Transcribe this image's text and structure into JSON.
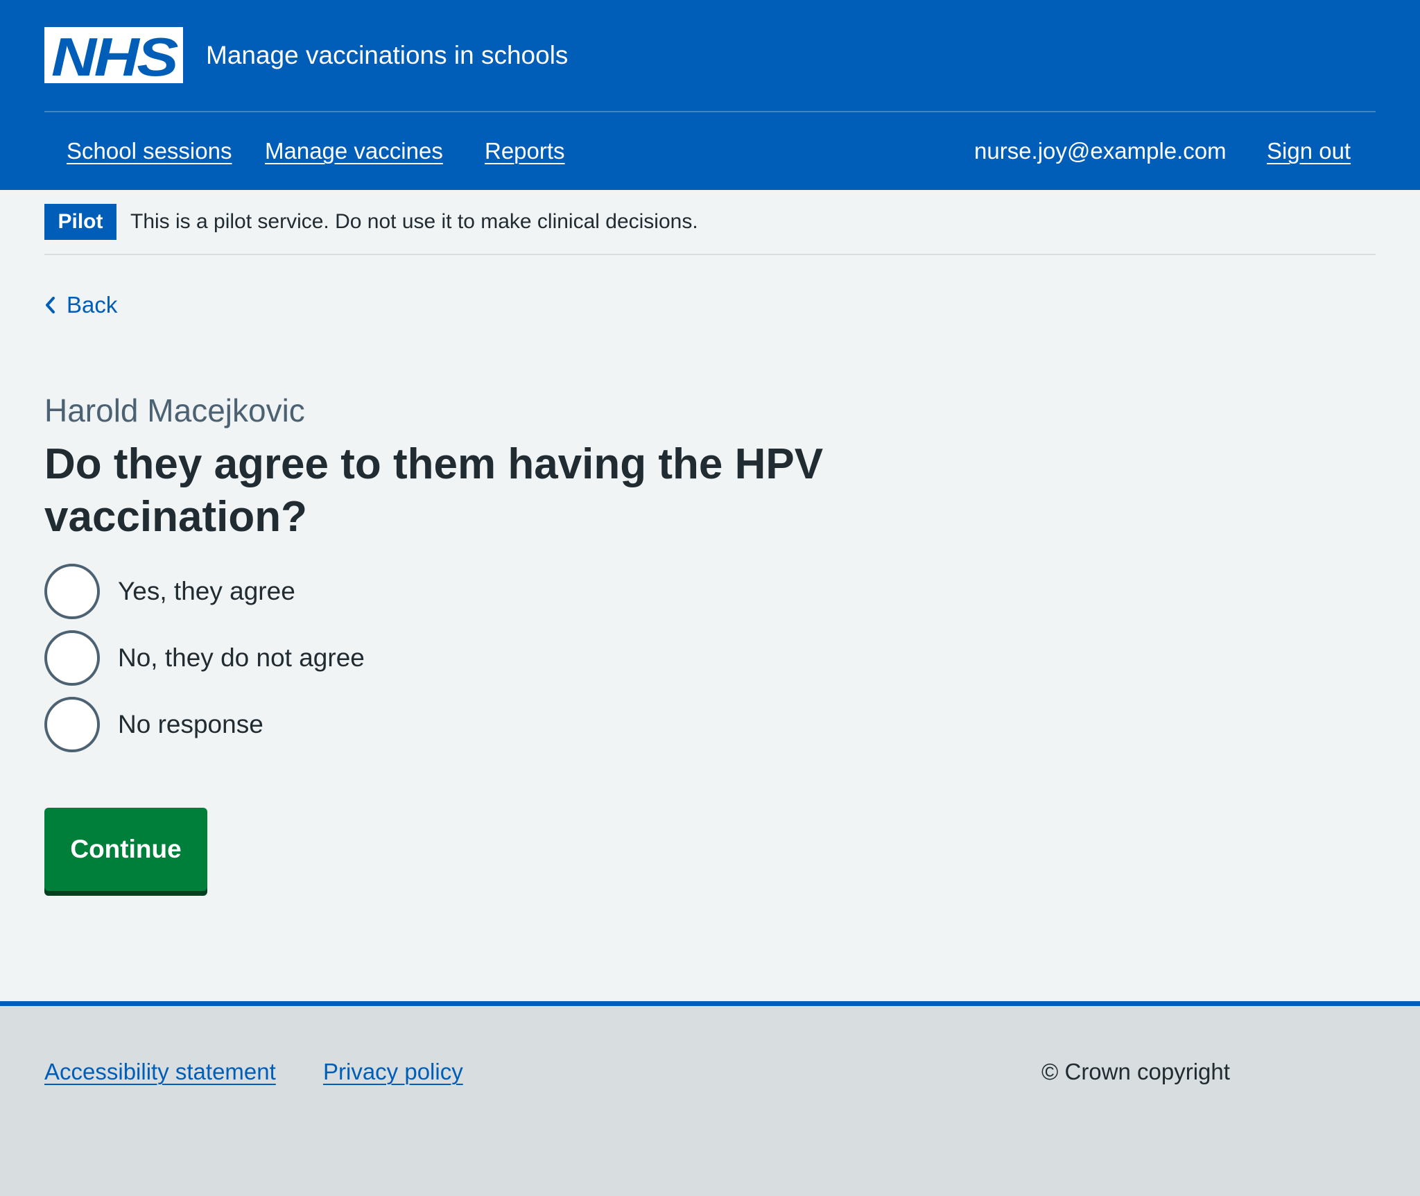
{
  "header": {
    "logo_text": "NHS",
    "service_name": "Manage vaccinations in schools",
    "nav": [
      {
        "label": "School sessions"
      },
      {
        "label": "Manage vaccines"
      },
      {
        "label": "Reports"
      }
    ],
    "account_email": "nurse.joy@example.com",
    "sign_out_label": "Sign out"
  },
  "phase_banner": {
    "tag": "Pilot",
    "text": "This is a pilot service. Do not use it to make clinical decisions."
  },
  "back_link": {
    "label": "Back",
    "icon": "chevron-left-icon"
  },
  "form": {
    "caption": "Harold Macejkovic",
    "question": "Do they agree to them having the HPV vaccination?",
    "options": [
      {
        "label": "Yes, they agree",
        "checked": false
      },
      {
        "label": "No, they do not agree",
        "checked": false
      },
      {
        "label": "No response",
        "checked": false
      }
    ],
    "submit_label": "Continue"
  },
  "footer": {
    "links": [
      {
        "label": "Accessibility statement"
      },
      {
        "label": "Privacy policy"
      }
    ],
    "copyright": "© Crown copyright"
  },
  "colors": {
    "nhs_blue": "#005eb8",
    "page_background": "#f0f4f5",
    "text": "#212b32",
    "secondary_text": "#4c6272",
    "button_green": "#007f3b",
    "button_shadow": "#00401e",
    "footer_background": "#d8dde0"
  }
}
